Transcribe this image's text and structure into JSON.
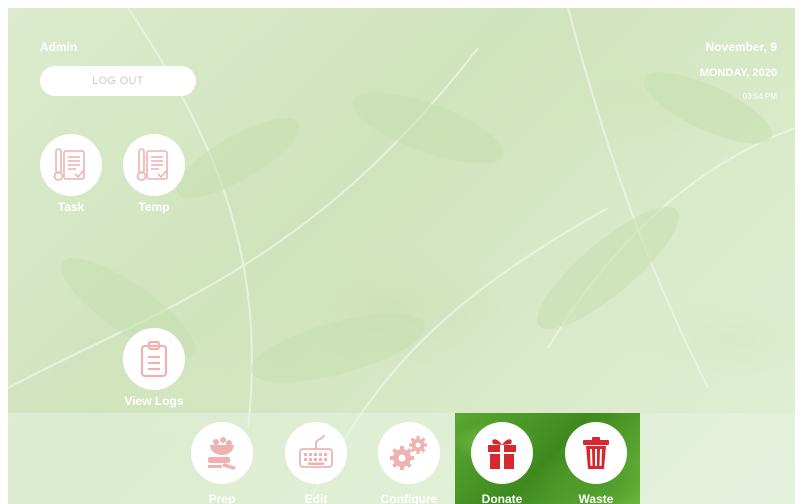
{
  "header": {
    "user": "Admin",
    "logout_label": "LOG OUT",
    "date_line1": "November, 9",
    "date_line2": "MONDAY, 2020",
    "time": "03:54 PM"
  },
  "tiles": [
    {
      "label": "Task",
      "icon": "task-clipboard-thermometer-icon"
    },
    {
      "label": "Temp",
      "icon": "temp-clipboard-thermometer-icon"
    },
    {
      "label": "View Logs",
      "icon": "clipboard-icon"
    }
  ],
  "bottom_bar": [
    {
      "label": "Prep",
      "icon": "prep-icon"
    },
    {
      "label": "Edit",
      "icon": "keyboard-icon"
    },
    {
      "label": "Configure",
      "icon": "gears-icon"
    },
    {
      "label": "Donate",
      "icon": "gift-icon"
    },
    {
      "label": "Waste",
      "icon": "trash-icon"
    }
  ],
  "colors": {
    "icon_soft": "#f0b8b8",
    "icon_strong": "#d7272f",
    "active_bg": "#4e9a2a"
  }
}
